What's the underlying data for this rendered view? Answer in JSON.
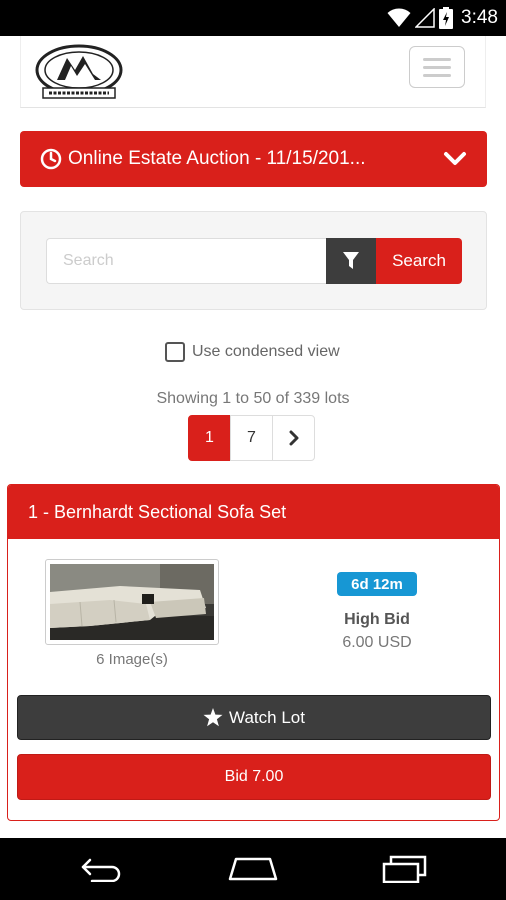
{
  "status_bar": {
    "time": "3:48"
  },
  "header": {
    "logo": "Duluth Auction Co. logo",
    "menu": "hamburger-menu"
  },
  "auction": {
    "title": "Online Estate Auction - 11/15/201...",
    "icon": "clock-icon",
    "toggle_icon": "chevron-down-icon"
  },
  "search": {
    "placeholder": "Search",
    "value": "",
    "filter_icon": "filter-icon",
    "button_label": "Search"
  },
  "options": {
    "condensed_label": "Use condensed view",
    "condensed_checked": false
  },
  "results": {
    "showing_text": "Showing 1 to 50 of 339 lots"
  },
  "pagination": {
    "pages": [
      "1",
      "7"
    ],
    "active": "1",
    "next_icon": "chevron-right-icon"
  },
  "lot": {
    "title": "1 - Bernhardt Sectional Sofa Set",
    "image_count": "6 Image(s)",
    "time_left": "6d 12m",
    "bid_label": "High Bid",
    "bid_value": "6.00 USD",
    "watch_label": "Watch Lot",
    "bid_button": "Bid 7.00"
  },
  "colors": {
    "accent": "#d9201b",
    "dark": "#3d3d3d",
    "badge": "#1797d4"
  }
}
